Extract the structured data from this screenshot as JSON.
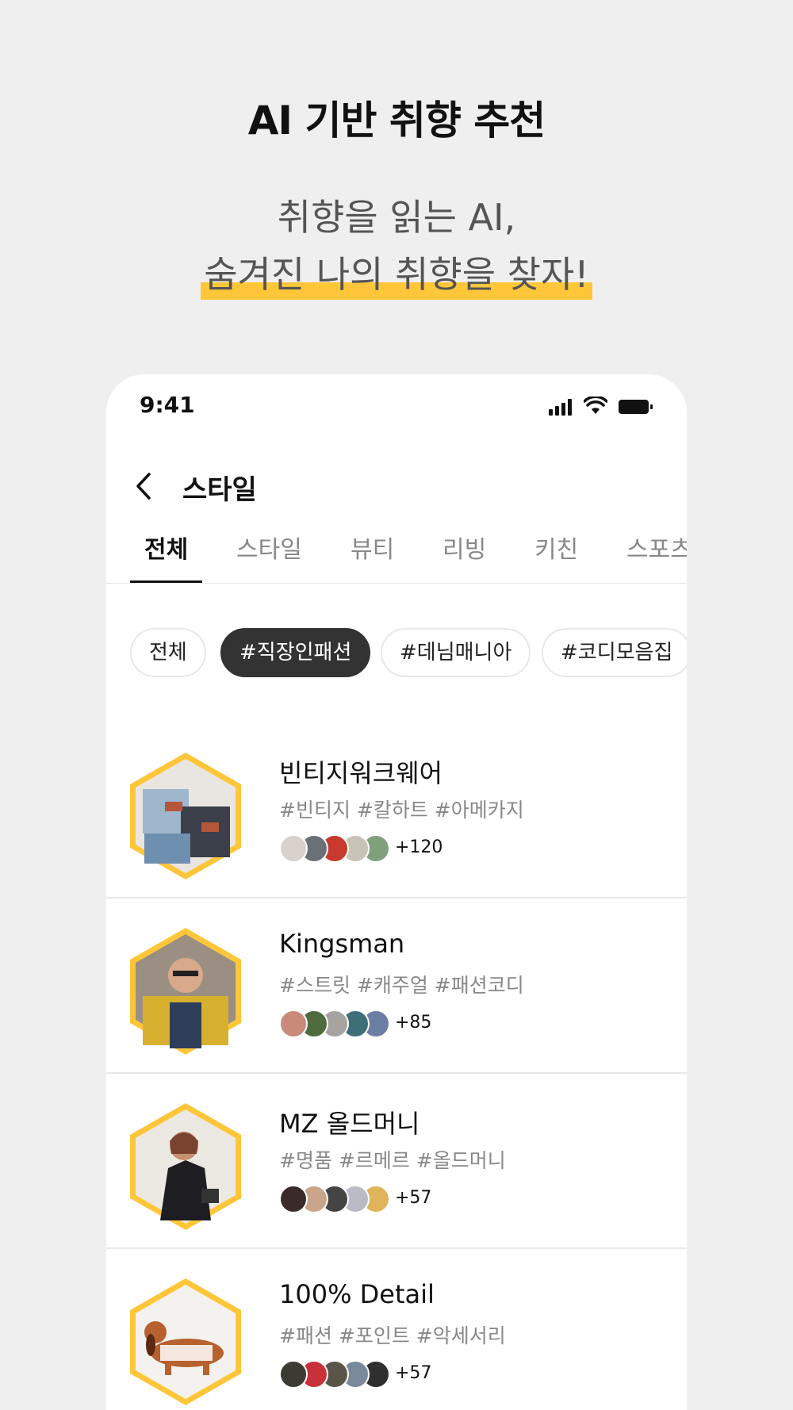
{
  "promo": {
    "title": "AI 기반 취향 추천",
    "subtitle_line1": "취향을 읽는 AI,",
    "subtitle_line2": "숨겨진 나의 취향을 찾자!"
  },
  "status_bar": {
    "time": "9:41"
  },
  "header": {
    "title": "스타일"
  },
  "tabs": [
    {
      "label": "전체",
      "active": true
    },
    {
      "label": "스타일"
    },
    {
      "label": "뷰티"
    },
    {
      "label": "리빙"
    },
    {
      "label": "키친"
    },
    {
      "label": "스포츠"
    }
  ],
  "chips": [
    {
      "label": "전체"
    },
    {
      "label": "#직장인패션",
      "active": true
    },
    {
      "label": "#데님매니아"
    },
    {
      "label": "#코디모음집"
    }
  ],
  "items": [
    {
      "title": "빈티지워크웨어",
      "tags": "#빈티지 #칼하트 #아메카지",
      "count": "+120",
      "avatar_colors": [
        "#d9d2cc",
        "#6b6f78",
        "#c8392e",
        "#c9c3b6",
        "#7fa07a"
      ]
    },
    {
      "title": "Kingsman",
      "tags": "#스트릿 #캐주얼 #패션코디",
      "count": "+85",
      "avatar_colors": [
        "#c98a7a",
        "#4e6a3e",
        "#a7a39e",
        "#3f6e78",
        "#6a7fa2"
      ]
    },
    {
      "title": "MZ 올드머니",
      "tags": "#명품 #르메르 #올드머니",
      "count": "+57",
      "avatar_colors": [
        "#3a2b2b",
        "#c9a58a",
        "#444444",
        "#b9bcc4",
        "#e0b45a"
      ]
    },
    {
      "title": "100% Detail",
      "tags": "#패션 #포인트 #악세서리",
      "count": "+57",
      "avatar_colors": [
        "#3b3b32",
        "#c8303a",
        "#5a5548",
        "#7b8a9a",
        "#2f2f2f"
      ]
    }
  ],
  "colors": {
    "accent": "#ffc63a",
    "active_chip": "#333333",
    "muted_text": "#888888"
  },
  "icons": [
    "signal-icon",
    "wifi-icon",
    "battery-icon",
    "back-arrow-icon"
  ]
}
